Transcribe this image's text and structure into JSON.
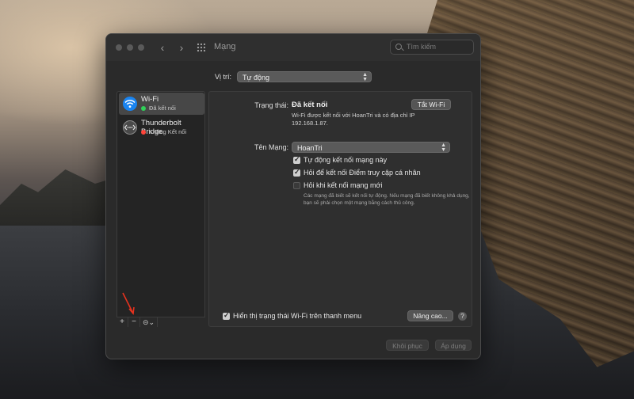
{
  "window": {
    "title": "Mạng"
  },
  "search": {
    "placeholder": "Tìm kiếm"
  },
  "location": {
    "label": "Vị trí:",
    "value": "Tự động"
  },
  "services": [
    {
      "name": "Wi-Fi",
      "status": "Đã kết nối",
      "status_color": "#30d158",
      "icon": "wifi-icon",
      "selected": true
    },
    {
      "name": "Thunderbolt Bridge",
      "status": "Không Kết nối",
      "status_color": "#ff453a",
      "icon": "thunderbolt-bridge-icon",
      "selected": false
    }
  ],
  "sidebar_controls": {
    "add": "+",
    "remove": "−",
    "action": "⊝⌄"
  },
  "detail": {
    "status_label": "Trạng thái:",
    "status_value": "Đã kết nối",
    "status_desc": "Wi-Fi được kết nối với HoanTri và có địa chỉ IP 192.168.1.87.",
    "turn_off_label": "Tắt Wi-Fi",
    "network_name_label": "Tên Mạng:",
    "network_name_value": "HoanTri",
    "checkboxes": [
      {
        "label": "Tự động kết nối mạng này",
        "checked": true
      },
      {
        "label": "Hỏi để kết nối Điểm truy cập cá nhân",
        "checked": true
      },
      {
        "label": "Hỏi khi kết nối mạng mới",
        "checked": false
      }
    ],
    "note": "Các mạng đã biết sẽ kết nối tự động. Nếu mạng đã biết không khả dụng, bạn sẽ phải chọn một mạng bằng cách thủ công.",
    "show_status_label": "Hiển thị trạng thái Wi-Fi trên thanh menu",
    "show_status_checked": true,
    "advanced_label": "Nâng cao...",
    "help": "?"
  },
  "footer": {
    "revert_label": "Khôi phục",
    "apply_label": "Áp dụng"
  },
  "annotation": {
    "arrow_color": "#e8321e"
  }
}
